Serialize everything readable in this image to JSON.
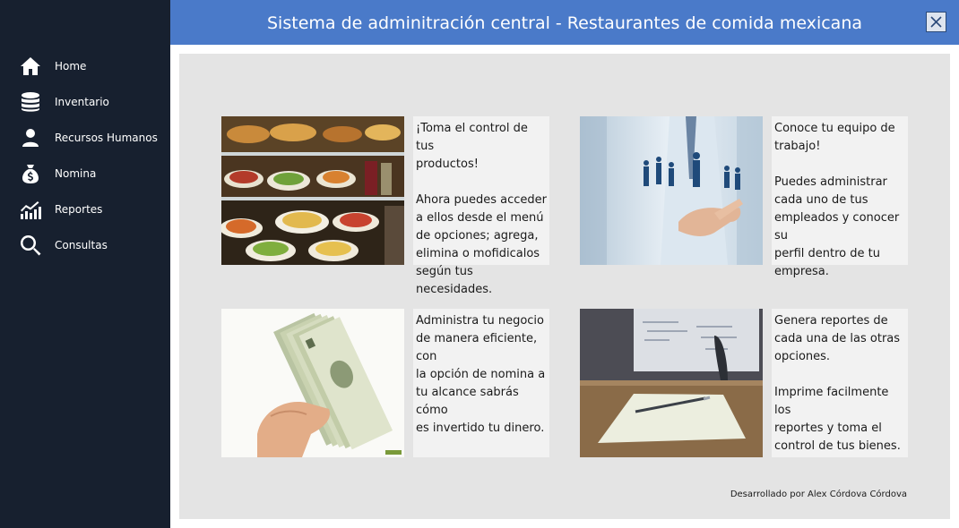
{
  "window": {
    "title": "Sistema de adminitración central - Restaurantes de comida mexicana",
    "close_icon": "close-icon"
  },
  "colors": {
    "sidebar_bg": "#17202f",
    "titlebar_bg": "#4a7ac9",
    "main_bg": "#e4e4e4",
    "card_text_bg": "#f2f2f2"
  },
  "sidebar": {
    "items": [
      {
        "label": "Home",
        "icon": "home-icon"
      },
      {
        "label": "Inventario",
        "icon": "database-icon"
      },
      {
        "label": "Recursos Humanos",
        "icon": "user-icon"
      },
      {
        "label": "Nomina",
        "icon": "money-bag-icon"
      },
      {
        "label": "Reportes",
        "icon": "chart-icon"
      },
      {
        "label": "Consultas",
        "icon": "search-icon"
      }
    ]
  },
  "cards": [
    {
      "image": "food-display-image",
      "paragraphs": [
        "¡Toma el control de tus\nproductos!",
        "Ahora puedes acceder\na ellos desde el menú\nde opciones; agrega,\nelimina o mofidicalos\nsegún tus necesidades."
      ]
    },
    {
      "image": "team-hand-image",
      "paragraphs": [
        "Conoce tu equipo de\ntrabajo!",
        "Puedes administrar\ncada uno de tus\nempleados y conocer su\nperfil dentro de tu\nempresa."
      ]
    },
    {
      "image": "money-hand-image",
      "paragraphs": [
        "Administra tu negocio\nde manera eficiente, con\nla opción de nomina a\ntu alcance sabrás cómo\nes invertido tu dinero."
      ]
    },
    {
      "image": "office-paper-image",
      "paragraphs": [
        "Genera reportes de\ncada una de las otras\nopciones.",
        "Imprime facilmente los\nreportes y toma el\ncontrol de tus bienes."
      ]
    }
  ],
  "footer": {
    "credit": "Desarrollado por Alex Córdova Córdova"
  }
}
